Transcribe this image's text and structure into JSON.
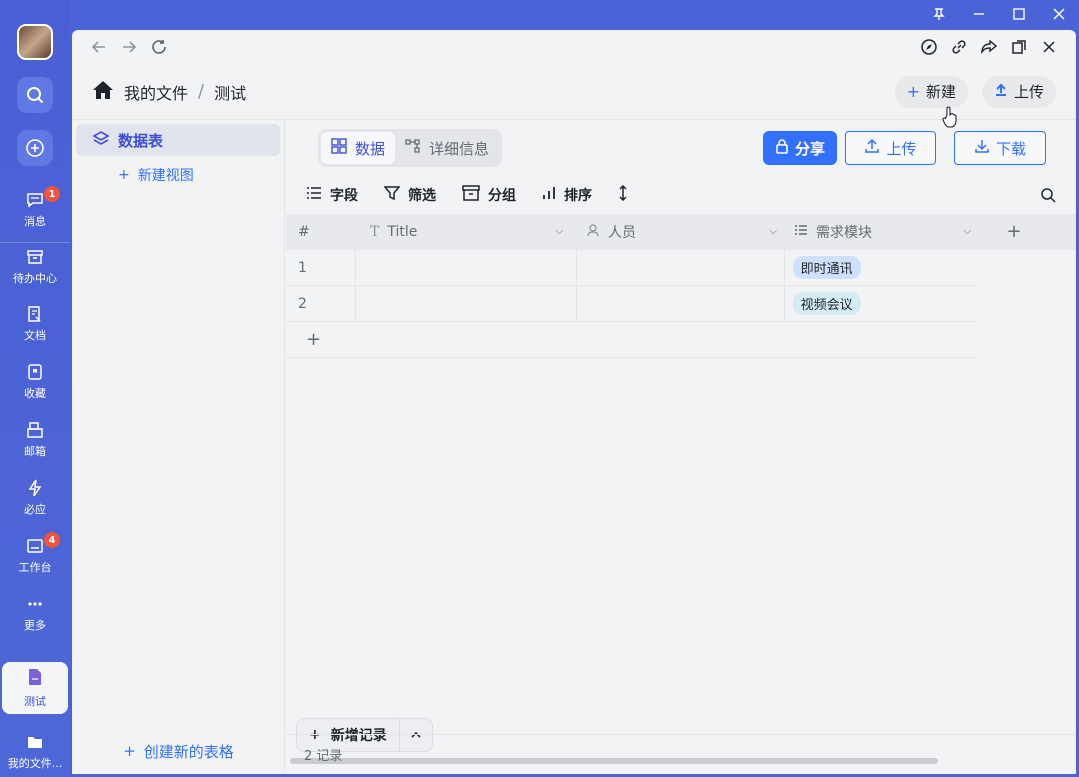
{
  "rail": {
    "items": [
      {
        "label": "消息",
        "badge": "1"
      },
      {
        "label": "待办中心"
      },
      {
        "label": "文档"
      },
      {
        "label": "收藏"
      },
      {
        "label": "邮箱"
      },
      {
        "label": "必应"
      },
      {
        "label": "工作台",
        "badge": "4"
      },
      {
        "label": "更多"
      }
    ],
    "active_label": "测试",
    "bottom_label": "我的文件..."
  },
  "header": {
    "breadcrumb": [
      "我的文件",
      "测试"
    ],
    "new_label": "新建",
    "upload_label": "上传"
  },
  "sidebar": {
    "table_label": "数据表",
    "new_view_label": "新建视图",
    "create_table_label": "创建新的表格"
  },
  "toolbar": {
    "tabs": [
      "数据",
      "详细信息"
    ],
    "share_label": "分享",
    "upload_label": "上传",
    "download_label": "下载",
    "field_label": "字段",
    "filter_label": "筛选",
    "group_label": "分组",
    "sort_label": "排序"
  },
  "grid": {
    "headers": {
      "num": "#",
      "title": "Title",
      "person": "人员",
      "module": "需求模块"
    },
    "rows": [
      {
        "num": "1",
        "title": "",
        "person": "",
        "module": "即时通讯",
        "tag_color": "#cfe0ff"
      },
      {
        "num": "2",
        "title": "",
        "person": "",
        "module": "视频会议",
        "tag_color": "#d4ecf3"
      }
    ],
    "add_record_label": "新增记录"
  },
  "footer": {
    "count_label": "2 记录"
  }
}
